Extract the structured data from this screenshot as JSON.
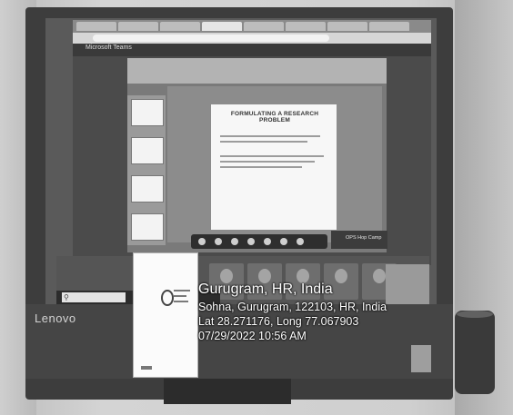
{
  "browser": {
    "teams_title": "Microsoft Teams"
  },
  "slide": {
    "title": "FORMULATING A RESEARCH PROBLEM"
  },
  "meeting": {
    "camera_label": "OPS Hop Camp"
  },
  "monitor": {
    "brand": "Lenovo"
  },
  "geotag": {
    "city": "Gurugram, HR, India",
    "address": "Sohna, Gurugram, 122103, HR, India",
    "coordinates": "Lat 28.271176, Long 77.067903",
    "datetime": "07/29/2022 10:56 AM"
  },
  "icons": {
    "search": "search-icon",
    "location": "location-pin-icon"
  }
}
